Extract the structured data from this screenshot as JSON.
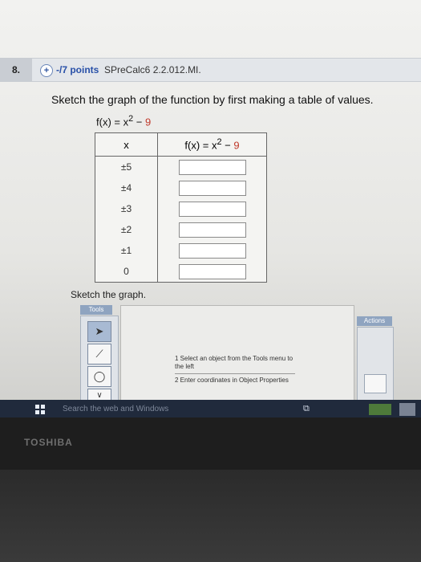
{
  "question": {
    "number": "8.",
    "points": "-/7 points",
    "id": "SPreCalc6 2.2.012.MI."
  },
  "prompt": "Sketch the graph of the function by first making a table of values.",
  "function_label": {
    "lhs": "f(x) = x",
    "exp": "2",
    "minus": " − ",
    "const": "9"
  },
  "table": {
    "x_header": "x",
    "fx_header_main": "f(x) = x",
    "fx_header_exp": "2",
    "fx_header_minus": " − ",
    "fx_header_const": "9",
    "rows": [
      "±5",
      "±4",
      "±3",
      "±2",
      "±1",
      "0"
    ]
  },
  "sketch_label": "Sketch the graph.",
  "tools_label": "Tools",
  "actions_label": "Actions",
  "instructions": {
    "step1": "1  Select an object from the Tools menu to the left",
    "step2": "2  Enter coordinates in Object Properties"
  },
  "taskbar": {
    "search_placeholder": "Search the web and Windows"
  },
  "brand": "TOSHIBA"
}
